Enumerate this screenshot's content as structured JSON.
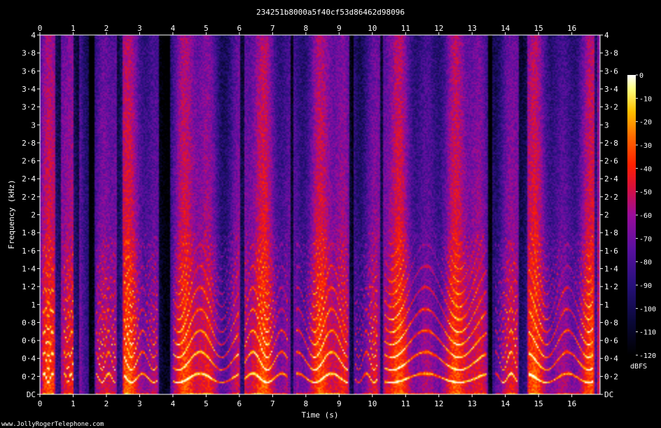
{
  "chart_data": {
    "type": "heatmap",
    "title": "234251b8000a5f40cf53d86462d98096",
    "xlabel": "Time (s)",
    "ylabel": "Frequency (kHz)",
    "xlim": [
      0,
      16.85
    ],
    "ylim": [
      0,
      4
    ],
    "x_ticks": [
      0,
      1,
      2,
      3,
      4,
      5,
      6,
      7,
      8,
      9,
      10,
      11,
      12,
      13,
      14,
      15,
      16
    ],
    "x_tick_labels": [
      "0",
      "1",
      "2",
      "3",
      "4",
      "5",
      "6",
      "7",
      "8",
      "9",
      "10",
      "11",
      "12",
      "13",
      "14",
      "15",
      "16"
    ],
    "y_ticks": [
      0,
      0.2,
      0.4,
      0.6,
      0.8,
      1,
      1.2,
      1.4,
      1.6,
      1.8,
      2,
      2.2,
      2.4,
      2.6,
      2.8,
      3,
      3.2,
      3.4,
      3.6,
      3.8,
      4
    ],
    "y_tick_labels": [
      "DC",
      "0·2",
      "0·4",
      "0·6",
      "0·8",
      "1",
      "1·2",
      "1·4",
      "1·6",
      "1·8",
      "2",
      "2·2",
      "2·4",
      "2·6",
      "2·8",
      "3",
      "3·2",
      "3·4",
      "3·6",
      "3·8",
      "4"
    ],
    "colorbar": {
      "label": "dBFS",
      "range": [
        -120,
        0
      ],
      "ticks": [
        0,
        -10,
        -20,
        -30,
        -40,
        -50,
        -60,
        -70,
        -80,
        -90,
        -100,
        -110,
        -120
      ],
      "tick_labels": [
        "0",
        "-10",
        "-20",
        "-30",
        "-40",
        "-50",
        "-60",
        "-70",
        "-80",
        "-90",
        "-100",
        "-110",
        "-120"
      ]
    },
    "silent_intervals_s": [
      [
        0.45,
        0.62
      ],
      [
        1.0,
        1.15
      ],
      [
        1.45,
        1.62
      ],
      [
        2.3,
        2.45
      ],
      [
        3.55,
        3.88
      ],
      [
        6.0,
        6.12
      ],
      [
        7.5,
        7.62
      ],
      [
        9.3,
        9.4
      ],
      [
        10.2,
        10.32
      ],
      [
        13.45,
        13.6
      ],
      [
        14.4,
        14.62
      ],
      [
        16.65,
        16.75
      ]
    ],
    "harmonic_segments_s": [
      [
        0.05,
        0.42
      ],
      [
        0.7,
        0.98
      ],
      [
        1.65,
        2.25
      ],
      [
        2.5,
        3.5
      ],
      [
        4.0,
        5.95
      ],
      [
        6.15,
        7.45
      ],
      [
        7.7,
        9.25
      ],
      [
        9.45,
        10.15
      ],
      [
        10.35,
        13.4
      ],
      [
        13.65,
        14.35
      ],
      [
        14.7,
        16.6
      ]
    ],
    "colors": {
      "background": "#000000",
      "text": "#ffffff"
    }
  },
  "footer": {
    "credit": "www.JollyRogerTelephone.com"
  }
}
